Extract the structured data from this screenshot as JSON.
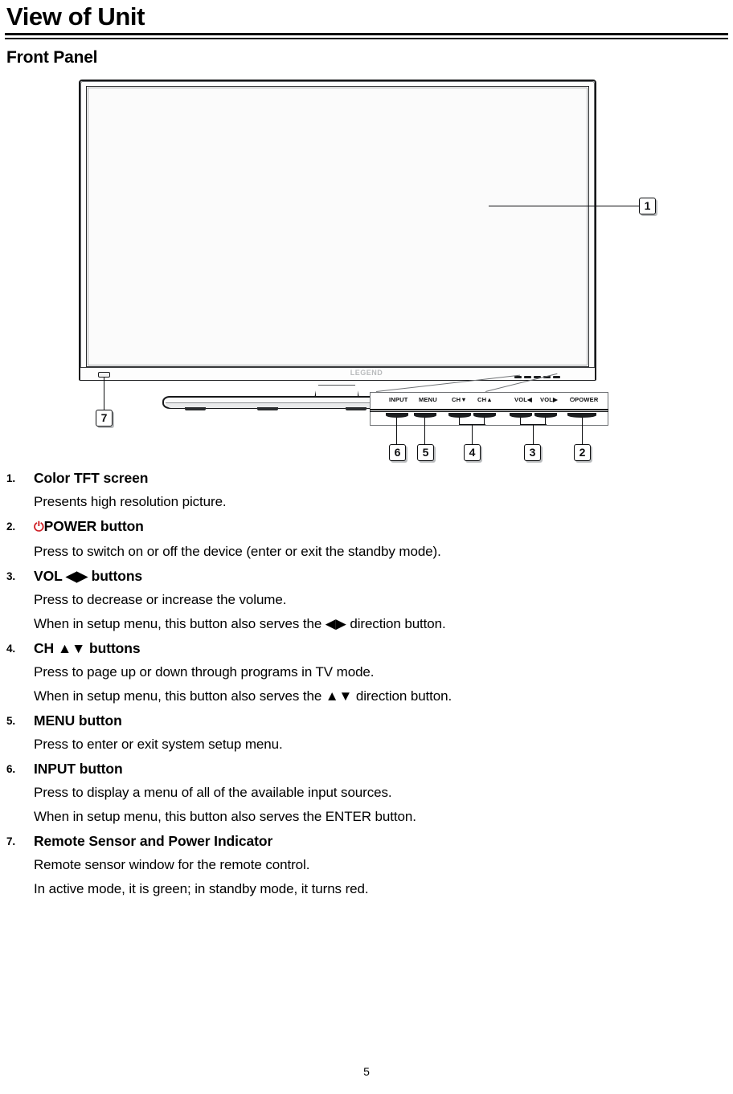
{
  "document": {
    "page_title": "View of Unit",
    "section_title": "Front Panel",
    "page_number": "5"
  },
  "figure": {
    "brand_logo": "LEGEND",
    "panel_labels": [
      {
        "id": "input",
        "text": "INPUT"
      },
      {
        "id": "menu",
        "text": "MENU"
      },
      {
        "id": "ch-down",
        "text": "CH▼"
      },
      {
        "id": "ch-up",
        "text": "CH▲"
      },
      {
        "id": "vol-down",
        "text": "VOL◀"
      },
      {
        "id": "vol-up",
        "text": "VOL▶"
      },
      {
        "id": "power",
        "text": "⏻POWER"
      }
    ],
    "callouts": [
      {
        "id": "1",
        "label": "1"
      },
      {
        "id": "2",
        "label": "2"
      },
      {
        "id": "3",
        "label": "3"
      },
      {
        "id": "4",
        "label": "4"
      },
      {
        "id": "5",
        "label": "5"
      },
      {
        "id": "6",
        "label": "6"
      },
      {
        "id": "7",
        "label": "7"
      }
    ]
  },
  "items": [
    {
      "num": "1.",
      "title": "Color TFT screen",
      "has_power_glyph": false,
      "lines": [
        "Presents high resolution picture."
      ]
    },
    {
      "num": "2.",
      "title": "POWER button",
      "power_glyph": "⏻",
      "has_power_glyph": true,
      "lines": [
        "Press to switch on or off the device (enter or exit the standby mode)."
      ]
    },
    {
      "num": "3.",
      "title": "VOL ◀▶ buttons",
      "has_power_glyph": false,
      "lines": [
        "Press to decrease or increase the volume.",
        "When in setup menu, this button also serves the ◀▶ direction button."
      ]
    },
    {
      "num": "4.",
      "title": "CH ▲▼ buttons",
      "has_power_glyph": false,
      "lines": [
        "Press to page up or down through programs in TV mode.",
        "When in setup menu, this button also serves the ▲▼ direction button."
      ]
    },
    {
      "num": "5.",
      "title": "MENU button",
      "has_power_glyph": false,
      "lines": [
        "Press to enter or exit system setup menu."
      ]
    },
    {
      "num": "6.",
      "title": "INPUT button",
      "has_power_glyph": false,
      "lines": [
        "Press to display a menu of all of the available input sources.",
        "When in setup menu, this button also serves the ENTER button."
      ]
    },
    {
      "num": "7.",
      "title": "Remote Sensor and Power Indicator",
      "has_power_glyph": false,
      "lines": [
        "Remote sensor window for the remote control.",
        "In active mode, it is green; in standby mode, it turns red."
      ]
    }
  ],
  "colors": {
    "power_glyph_red": "#cf2026",
    "ink": "#0d0e10",
    "logo_gray": "#b9bbbd"
  }
}
